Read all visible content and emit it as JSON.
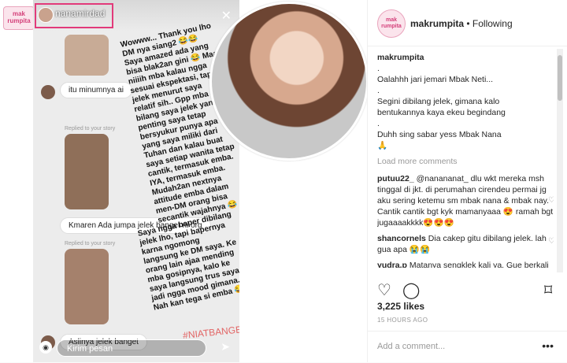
{
  "story": {
    "username": "nanamirdad",
    "logo_text": "mak rumpita",
    "reply_label_1": "Replied to your story",
    "reply_label_2": "Replied to your story",
    "bubble_1": "itu minumnya ai",
    "bubble_2": "Kmaren Ada jumpa jelek banget ni org",
    "bubble_3": "Aslinya jelek banget",
    "overlay_1": "Wowww... Thank you lho\nDM nya siang2 😂😂\nSaya amazed ada yang\nbisa blak2an gini 😂 Maaf\nniiiih mba kalau ngga\nsesuai ekspektasi, tapi\njelek menurut saya\nrelatif sih.. Gpp mba\nbilang saya jelek yang\npenting saya tetap\nbersyukur punya apa\nyang saya miliki dari\nTuhan dan kalau buat\nsaya setiap wanita tetap\ncantik, termasuk emba.\nIYA, termasuk emba.\nMudah2an nextnya\nattitude emba dalam\nmen-DM orang bisa\nsecantik wajahnya 😂",
    "overlay_2": "Saya ngga baper dibilang\njelek lho, tapi bapernya\nkarna ngomong\nlangsung ke DM saya. Ke\norang lain ajaa mending\nmba gosipnya, kalo ke\nsaya langsung trus saya\njadi ngga mood gimana...\nNah kan tega si emba 😂",
    "hashtag": "#NIATBANGETINI",
    "send_placeholder": "Kirim pesan"
  },
  "post": {
    "author": "makrumpita",
    "follow_state": "Following",
    "separator": "•",
    "brand_logo_text": "mak rumpita",
    "caption_author": "makrumpita",
    "caption_lines": [
      ".",
      "Oalahhh jari jemari Mbak Neti...",
      ".",
      "Segini dibilang jelek, gimana kalo",
      "bentukannya kaya ekeu begindang",
      ".",
      "Duhh sing sabar yess Mbak Nana",
      "🙏"
    ],
    "load_more": "Load more comments",
    "comments": [
      {
        "user": "putuu22_",
        "text": "@nanananat_ dlu wkt mereka msh tinggal di jkt. di perumahan cirendeu permai jg aku sering ketemu sm mbak nana & mbak nay. Cantik cantik bgt kyk mamanyaaa 😍 ramah bgt jugaaaakkkk😍😍😍"
      },
      {
        "user": "shancornels",
        "text": "Dia cakep gitu dibilang jelek. lah gua apa 😭😭"
      },
      {
        "user": "yudra.p",
        "text": "Matanya sengklek kali ya. Gue berkali kali ketemu ni artis di bali"
      }
    ],
    "likes": "3,225 likes",
    "time_ago": "15 HOURS AGO",
    "add_comment_placeholder": "Add a comment...",
    "more_label": "•••"
  },
  "icons": {
    "heart": "heart-icon",
    "comment": "comment-icon",
    "bookmark": "bookmark-icon",
    "send": "send-icon",
    "camera": "camera-icon",
    "close": "close-icon"
  },
  "colors": {
    "highlight": "#e23a7a",
    "hashtag": "#e26565",
    "brand_pink": "#d4407a"
  }
}
